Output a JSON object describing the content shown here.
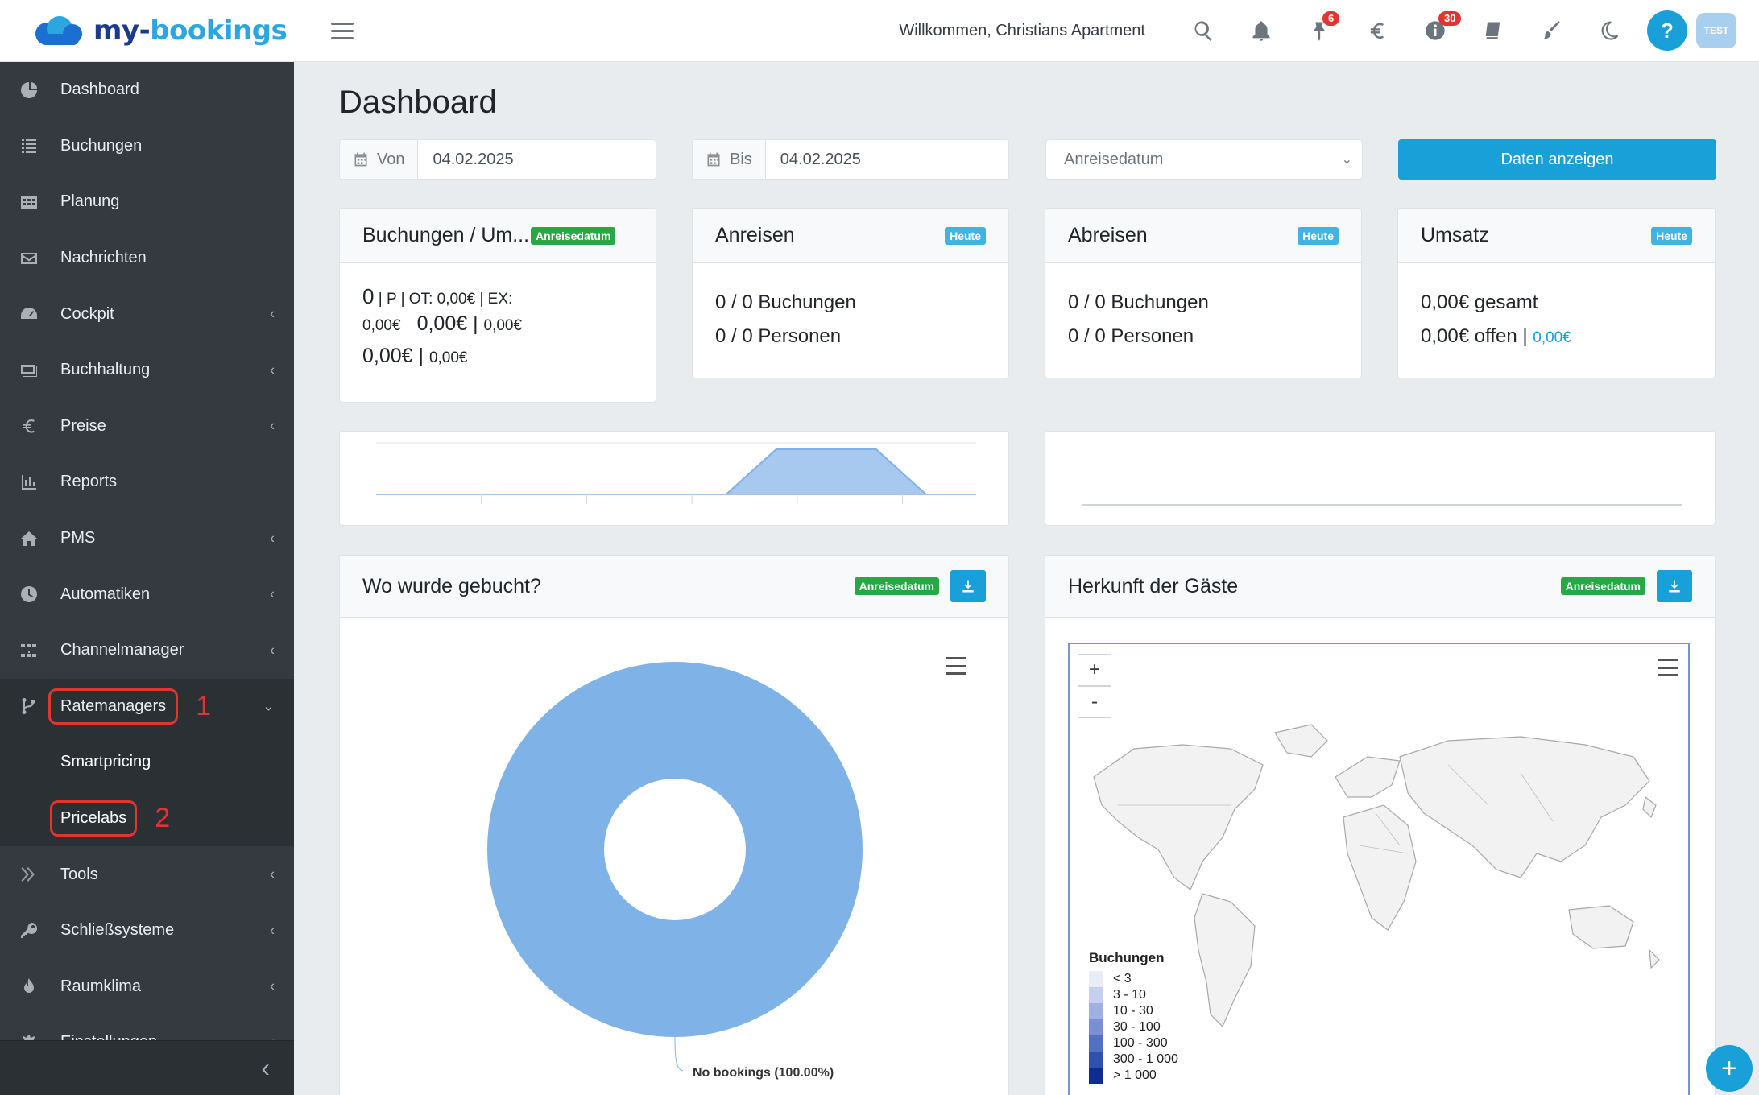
{
  "app": {
    "brand_main": "my-",
    "brand_accent": "bookings",
    "welcome": "Willkommen, Christians Apartment"
  },
  "topbar": {
    "badges": {
      "pin": "6",
      "info": "30"
    },
    "help_label": "?",
    "test_label": "TEST"
  },
  "sidebar": {
    "items": [
      {
        "label": "Dashboard",
        "icon": "dashboard-icon"
      },
      {
        "label": "Buchungen",
        "icon": "list-icon"
      },
      {
        "label": "Planung",
        "icon": "calendar-grid-icon"
      },
      {
        "label": "Nachrichten",
        "icon": "envelope-icon"
      },
      {
        "label": "Cockpit",
        "icon": "gauge-icon"
      },
      {
        "label": "Buchhaltung",
        "icon": "money-icon"
      },
      {
        "label": "Preise",
        "icon": "euro-icon"
      },
      {
        "label": "Reports",
        "icon": "bar-chart-icon"
      },
      {
        "label": "PMS",
        "icon": "home-icon"
      },
      {
        "label": "Automatiken",
        "icon": "clock-icon"
      },
      {
        "label": "Channelmanager",
        "icon": "sitemap-icon"
      },
      {
        "label": "Ratemanagers",
        "icon": "branch-icon"
      },
      {
        "label": "Tools",
        "icon": "tools-icon"
      },
      {
        "label": "Schließsysteme",
        "icon": "key-icon"
      },
      {
        "label": "Raumklima",
        "icon": "flame-icon"
      },
      {
        "label": "Einstellungen",
        "icon": "gear-icon"
      }
    ],
    "sub_items": [
      "Smartpricing",
      "Pricelabs"
    ],
    "annotations": [
      "1",
      "2"
    ],
    "collapse_glyph": "‹"
  },
  "main": {
    "title": "Dashboard",
    "filters": {
      "from_label": "Von",
      "from_value": "04.02.2025",
      "to_label": "Bis",
      "to_value": "04.02.2025",
      "select_value": "Anreisedatum",
      "button": "Daten anzeigen"
    },
    "cards": {
      "bookings": {
        "title": "Buchungen / Um...",
        "badge": "Anreisedatum",
        "line1_big": "0",
        "line1_small": " | P | OT: 0,00€ | EX:",
        "line2_small_a": "0,00€",
        "line2_big": "0,00€ | ",
        "line2_small_b": "0,00€",
        "line3_big": "0,00€ | ",
        "line3_small": "0,00€"
      },
      "arrivals": {
        "title": "Anreisen",
        "badge": "Heute",
        "line1": "0 / 0 Buchungen",
        "line2": "0 / 0 Personen"
      },
      "departures": {
        "title": "Abreisen",
        "badge": "Heute",
        "line1": "0 / 0 Buchungen",
        "line2": "0 / 0 Personen"
      },
      "revenue": {
        "title": "Umsatz",
        "badge": "Heute",
        "line1": "0,00€ gesamt",
        "line2": "0,00€ offen | ",
        "line2_link": "0,00€"
      }
    },
    "booked_where": {
      "title": "Wo wurde gebucht?",
      "badge": "Anreisedatum"
    },
    "guest_origin": {
      "title": "Herkunft der Gäste",
      "badge": "Anreisedatum",
      "zoom_in": "+",
      "zoom_out": "-",
      "legend_title": "Buchungen",
      "legend_items": [
        "< 3",
        "3 - 10",
        "10 - 30",
        "30 - 100",
        "100 - 300",
        "300 - 1 000",
        "> 1 000"
      ],
      "legend_colors": [
        "#e9edf9",
        "#c5cff0",
        "#9fb0e3",
        "#7a8fd4",
        "#5470c2",
        "#2f50ad",
        "#0d2c8e"
      ]
    },
    "fab_label": "+"
  },
  "chart_data": [
    {
      "type": "area",
      "x": [
        0,
        1,
        2,
        3,
        4,
        5,
        6,
        7,
        8,
        9,
        10,
        11,
        12
      ],
      "values": [
        0,
        0,
        0,
        0,
        0,
        0,
        0,
        0,
        1,
        1,
        1,
        0,
        0
      ],
      "title": "",
      "xlabel": "",
      "ylabel": "",
      "color": "#a7c8ef"
    },
    {
      "type": "pie",
      "categories": [
        "No bookings"
      ],
      "values": [
        100
      ],
      "labels": [
        "No bookings (100.00%)"
      ],
      "donut": true,
      "color": "#7fb3e8"
    }
  ]
}
